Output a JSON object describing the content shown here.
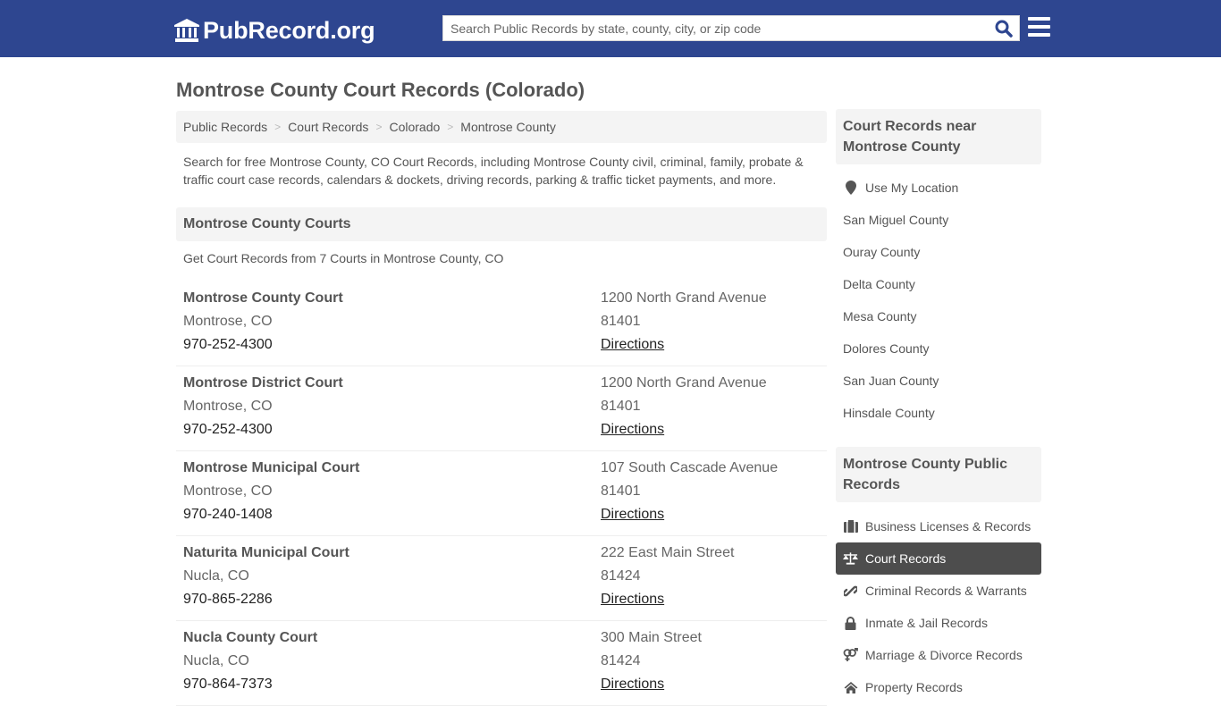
{
  "header": {
    "logo_text": "PubRecord.org",
    "search": {
      "placeholder": "Search Public Records by state, county, city, or zip code",
      "value": ""
    },
    "colors": {
      "bar": "#2e4690",
      "search_icon": "#2e4690"
    }
  },
  "page": {
    "title": "Montrose County Court Records (Colorado)",
    "breadcrumb": [
      {
        "label": "Public Records"
      },
      {
        "label": "Court Records"
      },
      {
        "label": "Colorado"
      },
      {
        "label": "Montrose County"
      }
    ],
    "breadcrumb_sep": ">",
    "intro": "Search for free Montrose County, CO Court Records, including Montrose County civil, criminal, family, probate & traffic court case records, calendars & dockets, driving records, parking & traffic ticket payments, and more."
  },
  "courts_section": {
    "heading": "Montrose County Courts",
    "subheading": "Get Court Records from 7 Courts in Montrose County, CO",
    "courts": [
      {
        "name": "Montrose County Court",
        "city": "Montrose, CO",
        "phone": "970-252-4300",
        "address": "1200 North Grand Avenue",
        "zip": "81401",
        "directions": "Directions"
      },
      {
        "name": "Montrose District Court",
        "city": "Montrose, CO",
        "phone": "970-252-4300",
        "address": "1200 North Grand Avenue",
        "zip": "81401",
        "directions": "Directions"
      },
      {
        "name": "Montrose Municipal Court",
        "city": "Montrose, CO",
        "phone": "970-240-1408",
        "address": "107 South Cascade Avenue",
        "zip": "81401",
        "directions": "Directions"
      },
      {
        "name": "Naturita Municipal Court",
        "city": "Nucla, CO",
        "phone": "970-865-2286",
        "address": "222 East Main Street",
        "zip": "81424",
        "directions": "Directions"
      },
      {
        "name": "Nucla County Court",
        "city": "Nucla, CO",
        "phone": "970-864-7373",
        "address": "300 Main Street",
        "zip": "81424",
        "directions": "Directions"
      }
    ]
  },
  "sidebar": {
    "nearby": {
      "heading": "Court Records near Montrose County",
      "use_location": {
        "label": "Use My Location",
        "icon": "map-marker-icon"
      },
      "counties": [
        "San Miguel County",
        "Ouray County",
        "Delta County",
        "Mesa County",
        "Dolores County",
        "San Juan County",
        "Hinsdale County"
      ]
    },
    "public_records": {
      "heading": "Montrose County Public Records",
      "items": [
        {
          "label": "Business Licenses & Records",
          "icon": "briefcase-icon",
          "active": false
        },
        {
          "label": "Court Records",
          "icon": "balance-scale-icon",
          "active": true
        },
        {
          "label": "Criminal Records & Warrants",
          "icon": "link-icon",
          "active": false
        },
        {
          "label": "Inmate & Jail Records",
          "icon": "lock-icon",
          "active": false
        },
        {
          "label": "Marriage & Divorce Records",
          "icon": "venus-mars-icon",
          "active": false
        },
        {
          "label": "Property Records",
          "icon": "home-icon",
          "active": false
        }
      ]
    }
  }
}
